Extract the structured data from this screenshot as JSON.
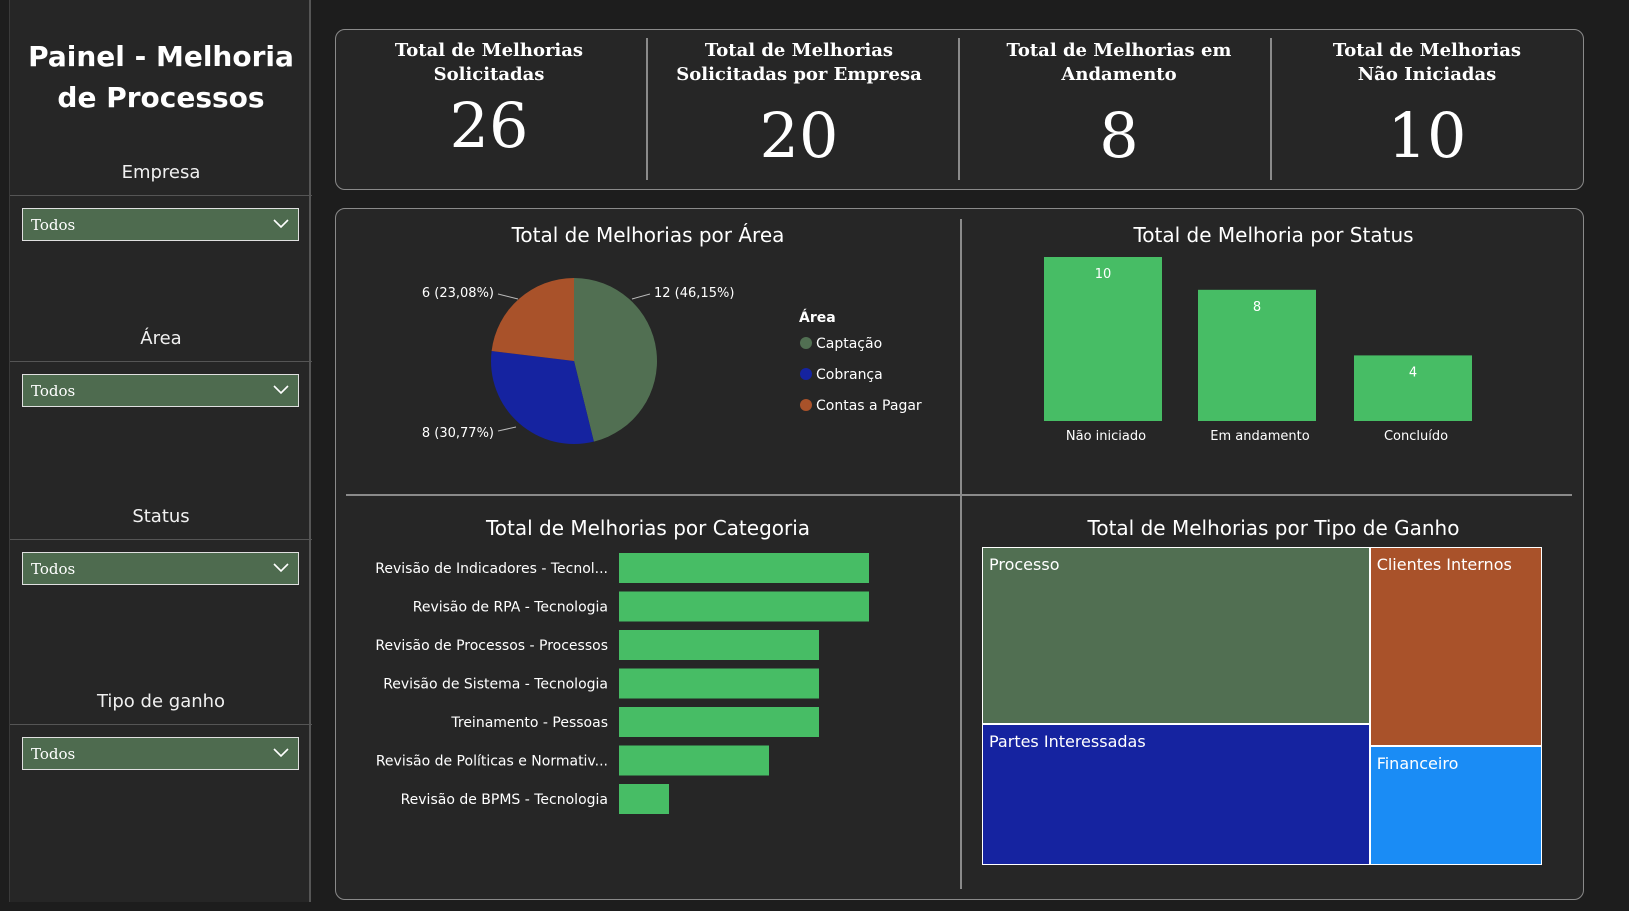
{
  "sidebar": {
    "title_line1": "Painel - Melhoria",
    "title_line2": "de Processos",
    "filters": [
      {
        "label": "Empresa",
        "value": "Todos"
      },
      {
        "label": "Área",
        "value": "Todos"
      },
      {
        "label": "Status",
        "value": "Todos"
      },
      {
        "label": "Tipo de ganho",
        "value": "Todos"
      }
    ]
  },
  "kpis": [
    {
      "label": "Total de Melhorias Solicitadas",
      "value": "26"
    },
    {
      "label": "Total de Melhorias Solicitadas por Empresa",
      "value": "20"
    },
    {
      "label": "Total de Melhorias em Andamento",
      "value": "8"
    },
    {
      "label": "Total de Melhorias Não Iniciadas",
      "value": "10"
    }
  ],
  "colors": {
    "green_bar": "#47bd65",
    "captacao": "#516f52",
    "cobranca": "#1523a0",
    "contas": "#a9522a",
    "financeiro": "#1a8cf5"
  },
  "chart_data": [
    {
      "type": "pie",
      "title": "Total de Melhorias por Área",
      "legend_title": "Área",
      "legend_position": "right",
      "categories": [
        "Captação",
        "Cobrança",
        "Contas a Pagar"
      ],
      "values": [
        12,
        8,
        6
      ],
      "data_labels": [
        "12 (46,15%)",
        "8 (30,77%)",
        "6 (23,08%)"
      ],
      "colors": [
        "#516f52",
        "#1523a0",
        "#a9522a"
      ]
    },
    {
      "type": "bar",
      "title": "Total de Melhoria por Status",
      "categories": [
        "Não iniciado",
        "Em andamento",
        "Concluído"
      ],
      "values": [
        10,
        8,
        4
      ],
      "ylim": [
        0,
        10
      ]
    },
    {
      "type": "bar",
      "orientation": "horizontal",
      "title": "Total de Melhorias por Categoria",
      "categories": [
        "Revisão de Indicadores - Tecnol...",
        "Revisão de RPA - Tecnologia",
        "Revisão de Processos - Processos",
        "Revisão de Sistema - Tecnologia",
        "Treinamento - Pessoas",
        "Revisão de Políticas e Normativ...",
        "Revisão de BPMS - Tecnologia"
      ],
      "values": [
        5,
        5,
        4,
        4,
        4,
        3,
        1
      ],
      "xlim": [
        0,
        5
      ]
    },
    {
      "type": "treemap",
      "title": "Total de Melhorias por Tipo de Ganho",
      "categories": [
        "Processo",
        "Partes Interessadas",
        "Clientes Internos",
        "Financeiro"
      ],
      "values": [
        10,
        8,
        5,
        3
      ],
      "colors": [
        "#516f52",
        "#1523a0",
        "#a9522a",
        "#1a8cf5"
      ]
    }
  ]
}
